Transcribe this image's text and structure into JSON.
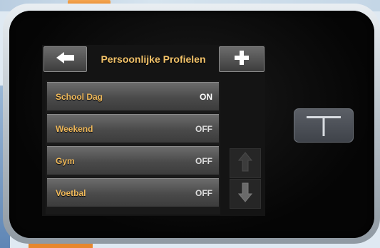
{
  "header": {
    "title": "Persoonlijke Profielen",
    "back_icon": "left-arrow-icon",
    "add_icon": "plus-icon"
  },
  "profiles": [
    {
      "name": "School Dag",
      "status": "ON"
    },
    {
      "name": "Weekend",
      "status": "OFF"
    },
    {
      "name": "Gym",
      "status": "OFF"
    },
    {
      "name": "Voetbal",
      "status": "OFF"
    }
  ],
  "scroll": {
    "up_icon": "up-arrow-icon",
    "down_icon": "down-arrow-icon",
    "up_enabled": false,
    "down_enabled": true
  },
  "device": {
    "home_button_icon": "t-logo-icon"
  },
  "colors": {
    "label_text": "#f0b95a",
    "title_text": "#f2c269",
    "screen_background": "#141414",
    "device_bezel": "#050505"
  }
}
